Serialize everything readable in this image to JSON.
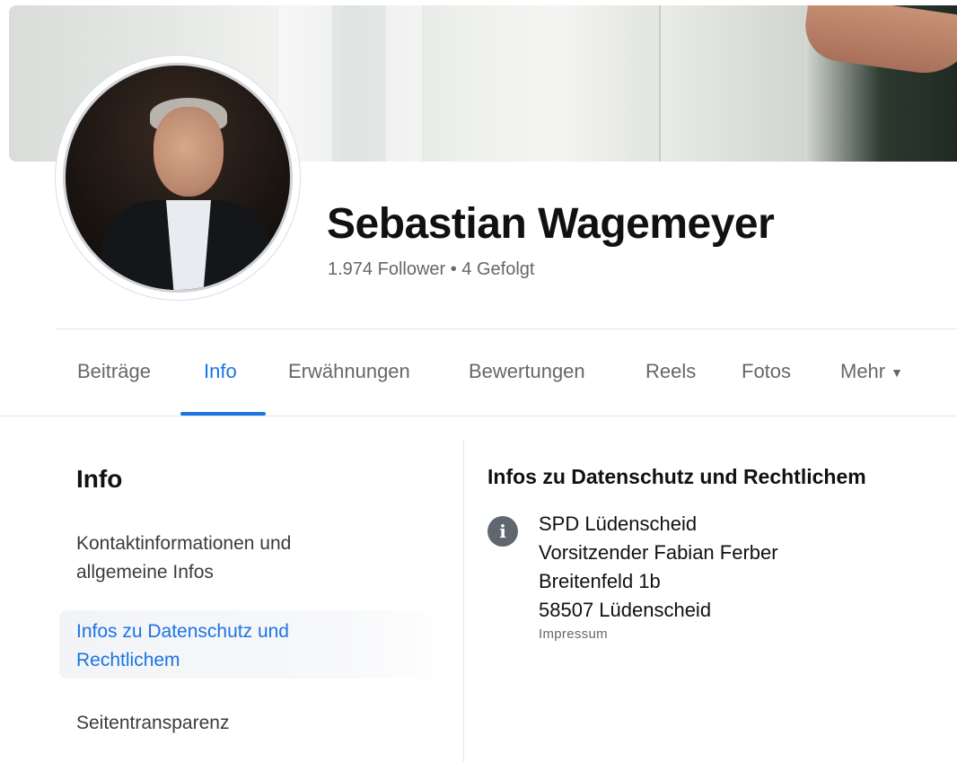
{
  "profile": {
    "name": "Sebastian Wagemeyer",
    "stats": "1.974 Follower • 4 Gefolgt"
  },
  "tabs": [
    {
      "label": "Beiträge"
    },
    {
      "label": "Info"
    },
    {
      "label": "Erwähnungen"
    },
    {
      "label": "Bewertungen"
    },
    {
      "label": "Reels"
    },
    {
      "label": "Fotos"
    },
    {
      "label": "Mehr"
    }
  ],
  "active_tab": "Info",
  "sidebar": {
    "title": "Info",
    "items": [
      {
        "label": "Kontaktinformationen und allgemeine Infos"
      },
      {
        "label": "Infos zu Datenschutz und Rechtlichem"
      },
      {
        "label": "Seitentransparenz"
      }
    ],
    "active_item": "Infos zu Datenschutz und Rechtlichem"
  },
  "content": {
    "title": "Infos zu Datenschutz und Rechtlichem",
    "icon": "info-icon",
    "address_lines": [
      "SPD Lüdenscheid",
      "Vorsitzender Fabian Ferber",
      "Breitenfeld 1b",
      "58507 Lüdenscheid"
    ],
    "caption": "Impressum"
  },
  "colors": {
    "accent": "#1b74e4",
    "secondary_text": "#65676b",
    "primary_text": "#111111"
  }
}
